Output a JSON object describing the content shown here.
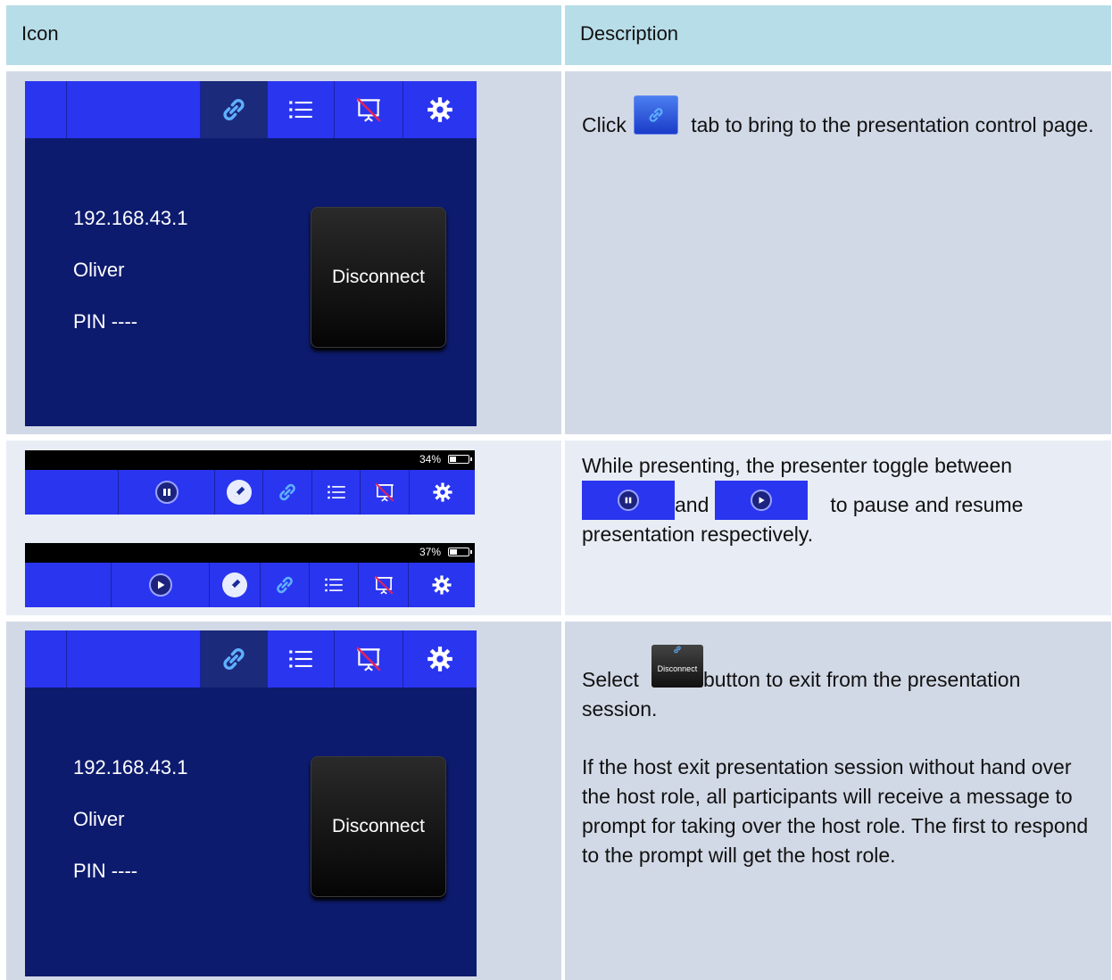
{
  "table": {
    "headers": [
      "Icon",
      "Description"
    ],
    "rows": [
      {
        "screen": {
          "ip": "192.168.43.1",
          "name": "Oliver",
          "pin": "PIN ----",
          "button": "Disconnect"
        },
        "desc_before": "Click",
        "desc_after": "tab to bring to the presentation control page."
      },
      {
        "bars": [
          {
            "battery": "34%",
            "control_icon": "pause-icon"
          },
          {
            "battery": "37%",
            "control_icon": "play-icon"
          }
        ],
        "desc_line1": "While presenting, the presenter toggle between",
        "desc_and": "and",
        "desc_line2": "to pause and resume presentation respectively."
      },
      {
        "screen": {
          "ip": "192.168.43.1",
          "name": "Oliver",
          "pin": "PIN ----",
          "button": "Disconnect"
        },
        "select_word": "Select",
        "inline_button_label": "Disconnect",
        "desc_after": "button to exit from the presentation session.",
        "desc_paragraph2": "If the host exit presentation session without hand over the host role, all participants will receive a message to prompt for taking over the host role. The first to respond to the prompt will get the host role."
      }
    ]
  },
  "colors": {
    "header_bg": "#b7dde8",
    "row_bg_dark": "#d2d9e6",
    "row_bg_light": "#e8edf5",
    "tab_bar": "#2a35f0",
    "screen_bg": "#0d1b6e"
  }
}
